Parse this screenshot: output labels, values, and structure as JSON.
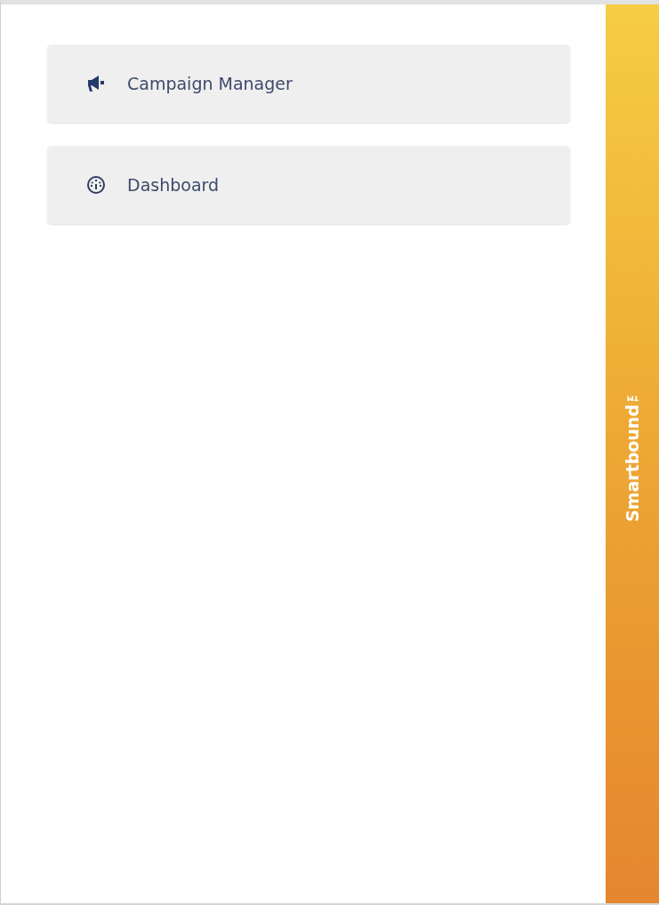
{
  "menu": [
    {
      "label": "Campaign Manager"
    },
    {
      "label": "Dashboard"
    }
  ],
  "side_tab": {
    "label": "Smartbound™"
  }
}
